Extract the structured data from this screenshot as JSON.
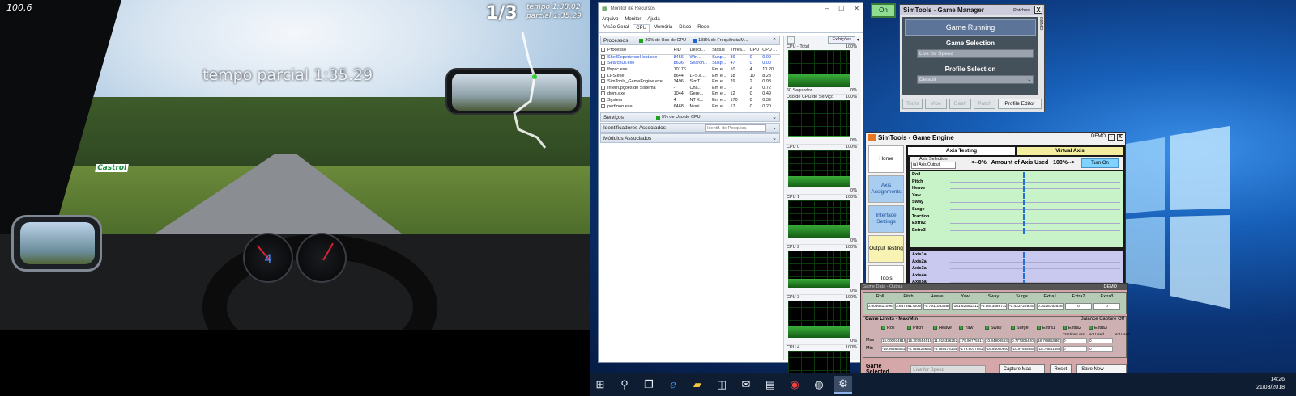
{
  "game": {
    "speed_readout": "100.6",
    "lap_count": "1/3",
    "lap_time_label": "tempo",
    "lap_time_value": "1:38.02",
    "split_label": "parcial",
    "split_value": "1:35.29",
    "center_split_text": "tempo parcial 1:35.29",
    "gear": "4",
    "logo_text": "Castrol"
  },
  "resmon": {
    "title": "Monitor de Recursos",
    "menu": [
      "Arquivo",
      "Monitor",
      "Ajuda"
    ],
    "tabs": [
      "Visão Geral",
      "CPU",
      "Memória",
      "Disco",
      "Rede"
    ],
    "active_tab": "CPU",
    "processes": {
      "title": "Processos",
      "cpu_use": "20% de Uso de CPU",
      "max_freq": "138% de Frequência M...",
      "columns": [
        "Processo",
        "PID",
        "Descr...",
        "Status",
        "Threa...",
        "CPU",
        "CPU ..."
      ],
      "rows": [
        {
          "name": "ShellExperienceHost.exe",
          "pid": "8456",
          "desc": "Win...",
          "status": "Susp...",
          "threads": "36",
          "cpu": "0",
          "cpu_avg": "0.00",
          "highlight": true
        },
        {
          "name": "SearchUI.exe",
          "pid": "8636",
          "desc": "Search...",
          "status": "Susp...",
          "threads": "47",
          "cpu": "0",
          "cpu_avg": "0.00",
          "highlight": true
        },
        {
          "name": "lfspsc.exe",
          "pid": "10176",
          "desc": "",
          "status": "Em e...",
          "threads": "10",
          "cpu": "4",
          "cpu_avg": "10.20",
          "highlight": false
        },
        {
          "name": "LFS.exe",
          "pid": "8644",
          "desc": "LFS.e...",
          "status": "Em e...",
          "threads": "18",
          "cpu": "10",
          "cpu_avg": "8.23",
          "highlight": false
        },
        {
          "name": "SimTools_GameEngine.exe",
          "pid": "3496",
          "desc": "SimT...",
          "status": "Em e...",
          "threads": "29",
          "cpu": "2",
          "cpu_avg": "0.98",
          "highlight": false
        },
        {
          "name": "Interrupções do Sistema",
          "pid": "-",
          "desc": "Cha...",
          "status": "Em e...",
          "threads": "-",
          "cpu": "2",
          "cpu_avg": "0.72",
          "highlight": false
        },
        {
          "name": "dwm.exe",
          "pid": "1044",
          "desc": "Gere...",
          "status": "Em e...",
          "threads": "12",
          "cpu": "0",
          "cpu_avg": "0.49",
          "highlight": false
        },
        {
          "name": "System",
          "pid": "4",
          "desc": "NT K...",
          "status": "Em e...",
          "threads": "170",
          "cpu": "0",
          "cpu_avg": "0.39",
          "highlight": false
        },
        {
          "name": "perfmon.exe",
          "pid": "6468",
          "desc": "Moni...",
          "status": "Em e...",
          "threads": "17",
          "cpu": "0",
          "cpu_avg": "0.20",
          "highlight": false
        }
      ]
    },
    "services": {
      "title": "Serviços",
      "cpu_use": "5% de Uso de CPU"
    },
    "handles": {
      "title": "Identificadores Associados",
      "search_placeholder": "Identif. de Pesquisa"
    },
    "modules": {
      "title": "Módulos Associados"
    },
    "right": {
      "views_button": "Exibições",
      "graphs": [
        {
          "label": "CPU - Total",
          "max": "100%",
          "min": "0%",
          "footer": "60 Segundos",
          "level": 0.35
        },
        {
          "label": "Uso de CPU de Serviço",
          "max": "100%",
          "min": "0%",
          "footer": "",
          "level": 0.05
        },
        {
          "label": "CPU 0",
          "max": "100%",
          "min": "0%",
          "footer": "",
          "level": 0.3
        },
        {
          "label": "CPU 1",
          "max": "100%",
          "min": "0%",
          "footer": "",
          "level": 0.35
        },
        {
          "label": "CPU 2",
          "max": "100%",
          "min": "0%",
          "footer": "",
          "level": 0.25
        },
        {
          "label": "CPU 3",
          "max": "100%",
          "min": "0%",
          "footer": "",
          "level": 0.3
        },
        {
          "label": "CPU 4",
          "max": "100%",
          "min": "",
          "footer": "",
          "level": 0.3
        }
      ]
    }
  },
  "game_manager": {
    "on_button": "On",
    "title": "SimTools - Game Manager",
    "patches": "Patches",
    "close": "X",
    "demo": "DEMO",
    "status": "Game Running",
    "game_selection_label": "Game Selection",
    "game_selection_value": "Live for Speed",
    "profile_selection_label": "Profile Selection",
    "profile_selection_value": "Default",
    "buttons": [
      "Tools",
      "Vibe",
      "Dash",
      "Patch",
      "Profile Editor"
    ]
  },
  "game_engine": {
    "title": "SimTools - Game Engine",
    "demo": "DEMO",
    "min": "-",
    "close": "X",
    "sidebar": [
      "Home",
      "Axis Assignments",
      "Interface Settings",
      "Output Testing",
      "Tools"
    ],
    "tabs": [
      "Axis Testing",
      "Virtual Axis"
    ],
    "axis_selection_label": "Axis Selection",
    "axis_selection_value": "(a) Axis Output",
    "axis_used_left": "<--0%",
    "axis_used_label": "Amount of Axis Used",
    "axis_used_right": "100%-->",
    "turn_on": "Turn On",
    "axes": [
      "Roll",
      "Pitch",
      "Heave",
      "Yaw",
      "Sway",
      "Surge",
      "Traction",
      "Extra2",
      "Extra3"
    ],
    "outputs": [
      "Axis1a",
      "Axis2a",
      "Axis3a",
      "Axis4a",
      "Axis5a",
      "Axis6a"
    ]
  },
  "output_window": {
    "title": "Game Data - Output",
    "demo": "DEMO",
    "data_headers": [
      "Roll",
      "Pitch",
      "Heave",
      "Yaw",
      "Sway",
      "Surge",
      "Extra1",
      "Extra2",
      "Extra3"
    ],
    "data_values": [
      "0.5086811096",
      "3.66746170036",
      "-0.7911083580",
      "-161.62391312",
      "-0.5643486731",
      "-0.4237269258",
      "0.30287926267",
      "0",
      "0"
    ],
    "limits_title": "Game Limits - Max/Min",
    "balance_capture": "Balance Capture Off",
    "limit_headers": [
      "Roll",
      "Pitch",
      "Heave",
      "Yaw",
      "Sway",
      "Surge",
      "Extra1",
      "Extra2",
      "Extra3"
    ],
    "handbrake_label": "Traction Loss",
    "not_used_1": "Not Used",
    "not_used_2": "Not Used",
    "max_label": "Max",
    "min_label": "Min",
    "max_values": [
      "15.000934815",
      "15.307554515",
      "11.915326252",
      "179.90775817",
      "10.849006531",
      "0.7773064208",
      "18.768815867",
      "0",
      "0"
    ],
    "min_values": [
      "-19.968834815",
      "-8.7684236500",
      "-8.7854781341",
      "-179.90775817",
      "-16.94060693",
      "-10.9758565471",
      "-18.768815867",
      "0",
      "0"
    ],
    "game_selected_label": "Game Selected",
    "game_selected_value": "Live for Speed",
    "capture_button": "Capture Max Min",
    "reset_button": "Reset",
    "save_button": "Save New Settings"
  },
  "taskbar": {
    "time": "14:26",
    "date": "21/03/2018"
  }
}
